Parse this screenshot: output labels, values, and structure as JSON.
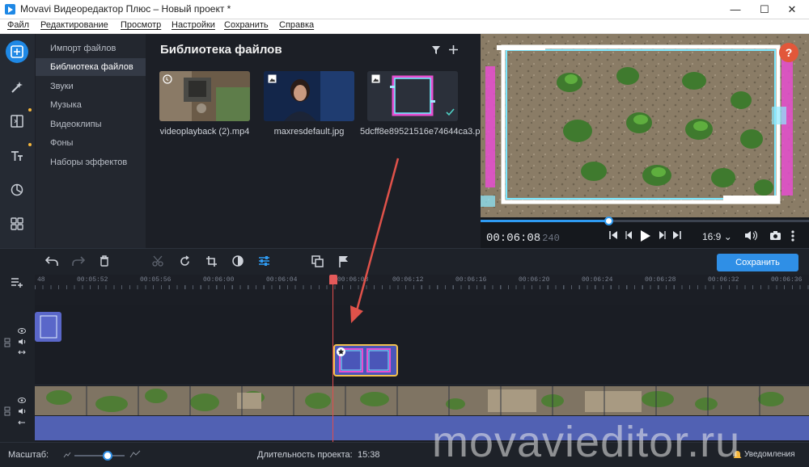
{
  "window": {
    "title": "Movavi Видеоредактор Плюс – Новый проект *",
    "controls": [
      "minimize",
      "maximize",
      "close"
    ]
  },
  "menu": [
    "Файл",
    "Редактирование",
    "Просмотр",
    "Настройки",
    "Сохранить",
    "Справка"
  ],
  "rail": {
    "icons": [
      "import-icon",
      "magic-wand-icon",
      "transitions-icon",
      "titles-icon",
      "stickers-icon",
      "more-tools-icon"
    ],
    "accent": "#1e88e5"
  },
  "categories": [
    {
      "label": "Импорт файлов",
      "active": false
    },
    {
      "label": "Библиотека файлов",
      "active": true
    },
    {
      "label": "Звуки",
      "active": false
    },
    {
      "label": "Музыка",
      "active": false
    },
    {
      "label": "Видеоклипы",
      "active": false
    },
    {
      "label": "Фоны",
      "active": false
    },
    {
      "label": "Наборы эффектов",
      "active": false
    }
  ],
  "library": {
    "title": "Библиотека файлов",
    "files": [
      {
        "name": "videoplayback (2).mp4",
        "icon": "video-icon"
      },
      {
        "name": "maxresdefault.jpg",
        "icon": "image-icon"
      },
      {
        "name": "5dcff8e89521516e74644ca3.png",
        "icon": "image-icon",
        "checked": true
      }
    ]
  },
  "preview": {
    "time_main": "00:06:08",
    "time_ms": ".240",
    "aspect": "16:9",
    "progress": 0.39
  },
  "timeline": {
    "ruler": [
      "48",
      "00:05:52",
      "00:05:56",
      "00:06:00",
      "00:06:04",
      "00:06:08",
      "00:06:12",
      "00:06:16",
      "00:06:20",
      "00:06:24",
      "00:06:28",
      "00:06:32",
      "00:06:36"
    ]
  },
  "toolbar": {
    "save_label": "Сохранить"
  },
  "status": {
    "scale_label": "Масштаб:",
    "duration_label": "Длительность проекта:",
    "duration_value": "15:38",
    "notifications": "Уведомления"
  },
  "watermark": "movavieditor.ru"
}
